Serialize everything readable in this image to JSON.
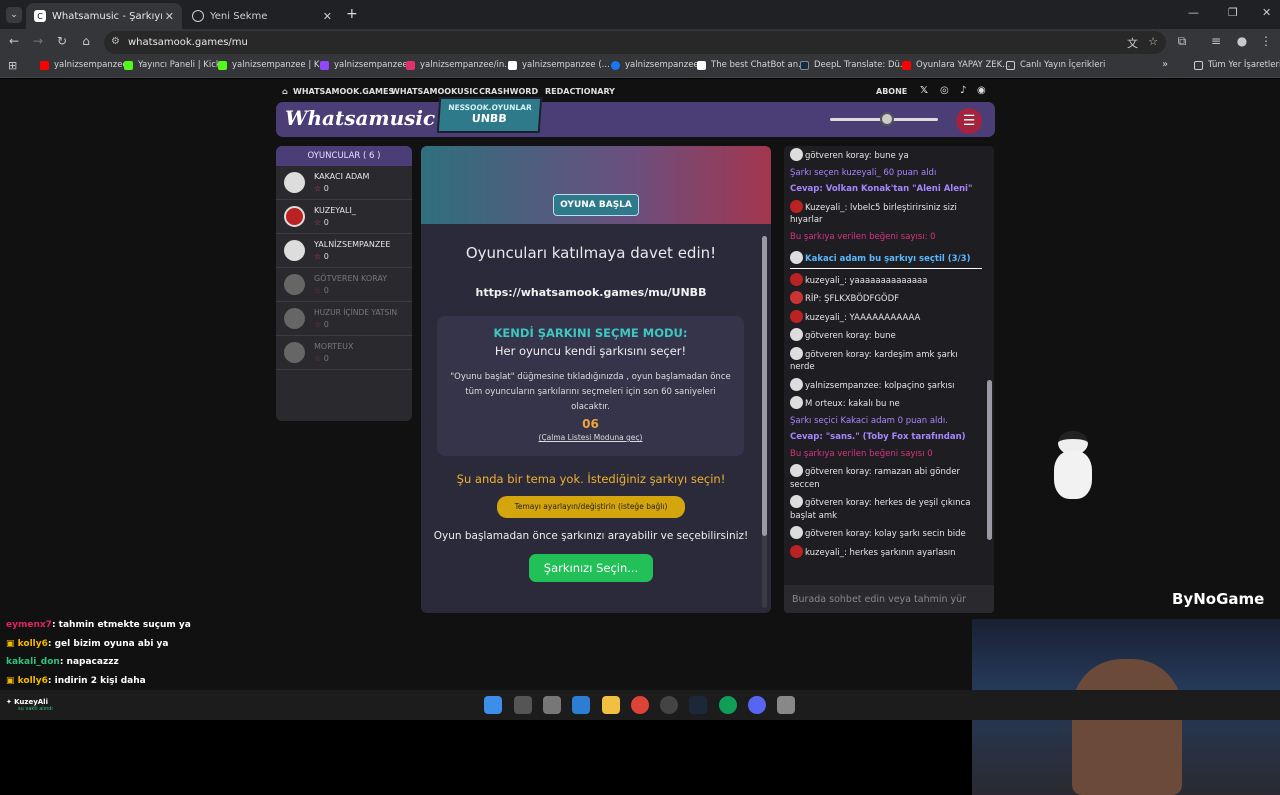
{
  "tabs": [
    {
      "title": "Whatsamusic - Şarkıyı Tahmin Et",
      "active": true
    },
    {
      "title": "Yeni Sekme",
      "active": false
    }
  ],
  "address": "whatsamook.games/mu",
  "bookmarks": [
    {
      "label": "yalnizsempanzee",
      "color": "#ff0000"
    },
    {
      "label": "Yayıncı Paneli | Kick",
      "color": "#53fc18"
    },
    {
      "label": "yalnizsempanzee | K...",
      "color": "#53fc18"
    },
    {
      "label": "yalnizsempanzee",
      "color": "#9146ff"
    },
    {
      "label": "yalnizsempanzee/in...",
      "color": "#e1306c"
    },
    {
      "label": "yalnizsempanzee (...",
      "color": "#ffffff"
    },
    {
      "label": "yalnizsempanzee",
      "color": "#1877f2"
    },
    {
      "label": "The best ChatBot an...",
      "color": "#ffffff"
    },
    {
      "label": "DeepL Translate: Dü...",
      "color": "#0f2b46"
    },
    {
      "label": "Oyunlara YAPAY ZEK...",
      "color": "#ff0000"
    },
    {
      "label": "Canlı Yayın İçerikleri",
      "color": "#cccccc"
    }
  ],
  "bookmarks_all": "Tüm Yer İşaretleri",
  "site": {
    "nav": [
      "WHATSAMOOK.GAMES",
      "WHATSAMOOKUSIC",
      "CRASHWORD",
      "REDACTIONARY"
    ],
    "abone": "ABONE",
    "logo": "Whatsamusic",
    "badge_small": "NESSOOK.OYUNLAR",
    "badge_big": "UNBB"
  },
  "players": {
    "title": "OYUNCULAR ( 6 )",
    "list": [
      {
        "name": "KAKACI ADAM",
        "score": "0",
        "active": true
      },
      {
        "name": "KUZEYALI_",
        "score": "0",
        "active": true
      },
      {
        "name": "YALNİZSEMPANZEE",
        "score": "0",
        "active": true
      },
      {
        "name": "GÖTVEREN KORAY",
        "score": "0",
        "active": false
      },
      {
        "name": "HUZUR İÇİNDE YATSIN",
        "score": "0",
        "active": false
      },
      {
        "name": "MORTEUX",
        "score": "0",
        "active": false
      }
    ]
  },
  "game": {
    "start": "OYUNA BAŞLA",
    "invite": "Oyuncuları katılmaya davet edin!",
    "url": "https://whatsamook.games/mu/UNBB",
    "mode_title": "KENDİ ŞARKINI SEÇME MODU:",
    "mode_sub": "Her oyuncu kendi şarkısını seçer!",
    "mode_desc": "\"Oyunu başlat\" düğmesine tıkladığınızda , oyun başlamadan önce tüm oyuncuların şarkılarını seçmeleri için son 60 saniyeleri olacaktır.",
    "countdown": "06",
    "playlist_link": "(Çalma Listesi Moduna geç)",
    "theme_note": "Şu anda bir tema yok. İstediğiniz şarkıyı seçin!",
    "theme_button": "Temayı ayarlayın/değiştirin (isteğe bağlı)",
    "pick_text": "Oyun başlamadan önce şarkınızı arayabilir ve seçebilirsiniz!",
    "pick_button": "Şarkınızı Seçin..."
  },
  "chat": {
    "messages": [
      {
        "type": "user",
        "text": "götveren koray: bune ya"
      },
      {
        "type": "sys",
        "text": "Şarkı seçen kuzeyali_ 60 puan aldı"
      },
      {
        "type": "ans",
        "text": "Cevap: Volkan Konak'tan \"Aleni Aleni\""
      },
      {
        "type": "user",
        "text": "Kuzeyali_: lvbelc5 birleştirirsiniz sizi hıyarlar"
      },
      {
        "type": "likes",
        "text": "Bu şarkıya verilen beğeni sayısı: 0"
      },
      {
        "type": "sel",
        "text": "Kakaci adam bu şarkıyı seçtil (3/3)"
      },
      {
        "type": "user",
        "text": "kuzeyali_: yaaaaaaaaaaaaaa"
      },
      {
        "type": "user",
        "text": "RİP: ŞFLKXBÖDFGÖDF"
      },
      {
        "type": "user",
        "text": "kuzeyali_: YAAAAAAAAAAA"
      },
      {
        "type": "user",
        "text": "götveren koray: bune"
      },
      {
        "type": "user",
        "text": "götveren koray: kardeşim amk şarkı nerde"
      },
      {
        "type": "user",
        "text": "yalnizsempanzee: kolpaçino şarkısı"
      },
      {
        "type": "user",
        "text": "M orteux: kakalı bu ne"
      },
      {
        "type": "sys",
        "text": "Şarkı seçici Kakaci adam 0 puan aldı."
      },
      {
        "type": "ans",
        "text": "Cevap: \"sans.\" (Toby Fox tarafından)"
      },
      {
        "type": "likes",
        "text": "Bu şarkıya verilen beğeni sayısı 0"
      },
      {
        "type": "user",
        "text": "götveren koray: ramazan abi gönder seccen"
      },
      {
        "type": "user",
        "text": "götveren koray: herkes de yeşil çıkınca başlat amk"
      },
      {
        "type": "user",
        "text": "götveren koray: kolay şarkı secin bide"
      },
      {
        "type": "user",
        "text": "kuzeyali_: herkes şarkının ayarlasın"
      }
    ],
    "placeholder": "Burada sohbet edin veya tahmin yür"
  },
  "stream_chat": [
    {
      "user": "eymenx7",
      "text": ": tahmin etmekte suçum ya",
      "color": "#e0245e"
    },
    {
      "user": "kolly6",
      "text": ": gel bizim oyuna abi ya",
      "color": "#f5b800"
    },
    {
      "user": "kakali_don",
      "text": ": napacazzz",
      "color": "#2ec27e"
    },
    {
      "user": "kolly6",
      "text": ": indirin 2 kişi daha",
      "color": "#f5b800"
    }
  ],
  "stream_user": {
    "name": "KuzeyAli",
    "status": "su vakti alındı"
  },
  "brand": "ByNoGame"
}
